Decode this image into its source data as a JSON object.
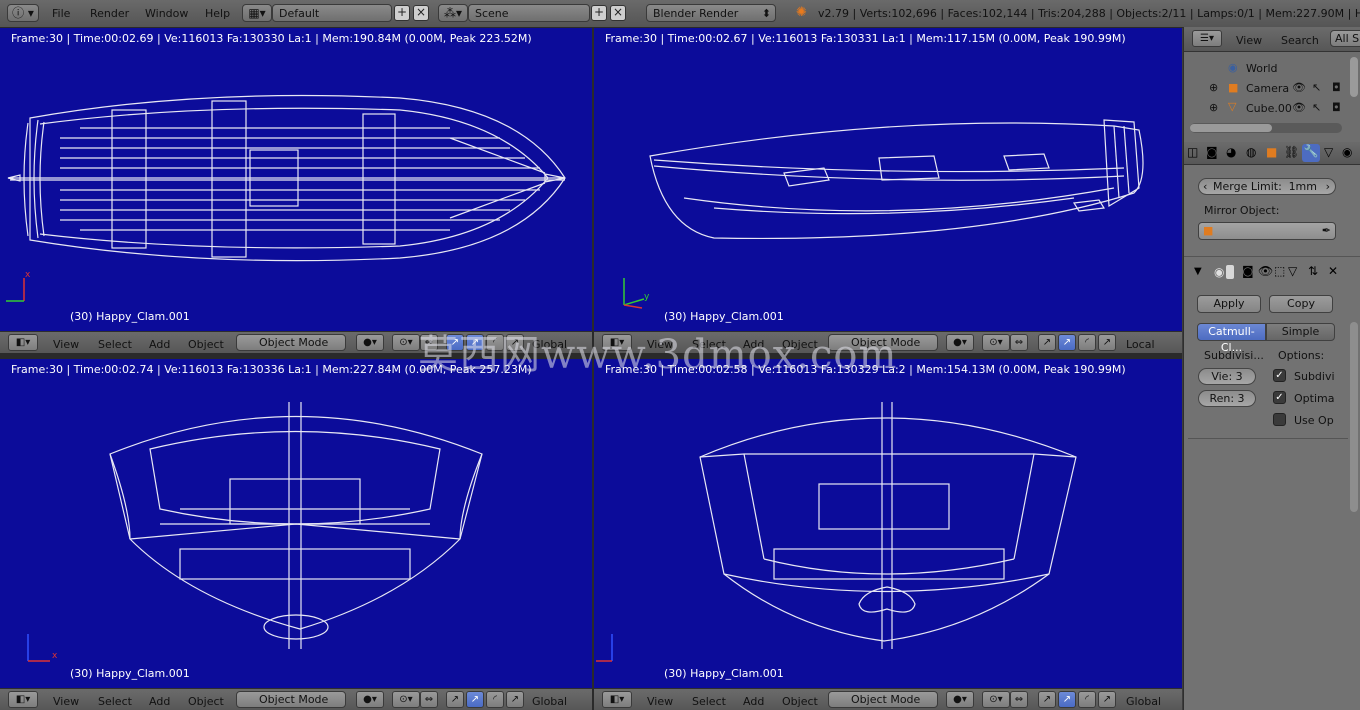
{
  "topbar": {
    "menus": [
      "File",
      "Render",
      "Window",
      "Help"
    ],
    "screen_layout": "Default",
    "scene": "Scene",
    "render_engine": "Blender Render",
    "stats": "v2.79 | Verts:102,696 | Faces:102,144 | Tris:204,288 | Objects:2/11 | Lamps:0/1 | Mem:227.90M | Happy_"
  },
  "viewports": {
    "top_left": {
      "info": "Frame:30 | Time:00:02.69 | Ve:116013 Fa:130330 La:1 | Mem:190.84M (0.00M, Peak 223.52M)",
      "object": "(30) Happy_Clam.001",
      "header": {
        "view": "View",
        "select": "Select",
        "add": "Add",
        "object": "Object",
        "mode": "Object Mode",
        "orientation": "Global"
      }
    },
    "top_right": {
      "info": "Frame:30 | Time:00:02.67 | Ve:116013 Fa:130331 La:1 | Mem:117.15M (0.00M, Peak 190.99M)",
      "object": "(30) Happy_Clam.001",
      "header": {
        "view": "View",
        "select": "Select",
        "add": "Add",
        "object": "Object",
        "mode": "Object Mode",
        "orientation": "Local"
      }
    },
    "bottom_left": {
      "info": "Frame:30 | Time:00:02.74 | Ve:116013 Fa:130336 La:1 | Mem:227.84M (0.00M, Peak 257.23M)",
      "object": "(30) Happy_Clam.001",
      "header": {
        "view": "View",
        "select": "Select",
        "add": "Add",
        "object": "Object",
        "mode": "Object Mode",
        "orientation": "Global"
      }
    },
    "bottom_right": {
      "info": "Frame:30 | Time:00:02.58 | Ve:116013 Fa:130329 La:2 | Mem:154.13M (0.00M, Peak 190.99M)",
      "object": "(30) Happy_Clam.001",
      "header": {
        "view": "View",
        "select": "Select",
        "add": "Add",
        "object": "Object",
        "mode": "Object Mode",
        "orientation": "Global"
      }
    }
  },
  "outliner": {
    "view": "View",
    "search": "Search",
    "filter": "All S",
    "items": [
      "World",
      "Camera",
      "Cube.00"
    ]
  },
  "properties": {
    "merge_limit_label": "Merge Limit:",
    "merge_limit_value": "1mm",
    "mirror_object_label": "Mirror Object:",
    "apply": "Apply",
    "copy": "Copy",
    "catmull": "Catmull-Cl...",
    "simple": "Simple",
    "subdivisions_label": "Subdivisi...",
    "options_label": "Options:",
    "view_levels": "Vie:  3",
    "render_levels": "Ren:  3",
    "opt_subdiv_uvs": "Subdivi",
    "opt_optimal": "Optima",
    "opt_use_opensubdiv": "Use Op",
    "checked": [
      true,
      true,
      false
    ]
  },
  "watermark": "莫西网www.3dmox.com",
  "colors": {
    "viewport_bg": "#0c0c9a",
    "active_blue": "#4d6cc1",
    "panel": "#727272"
  }
}
